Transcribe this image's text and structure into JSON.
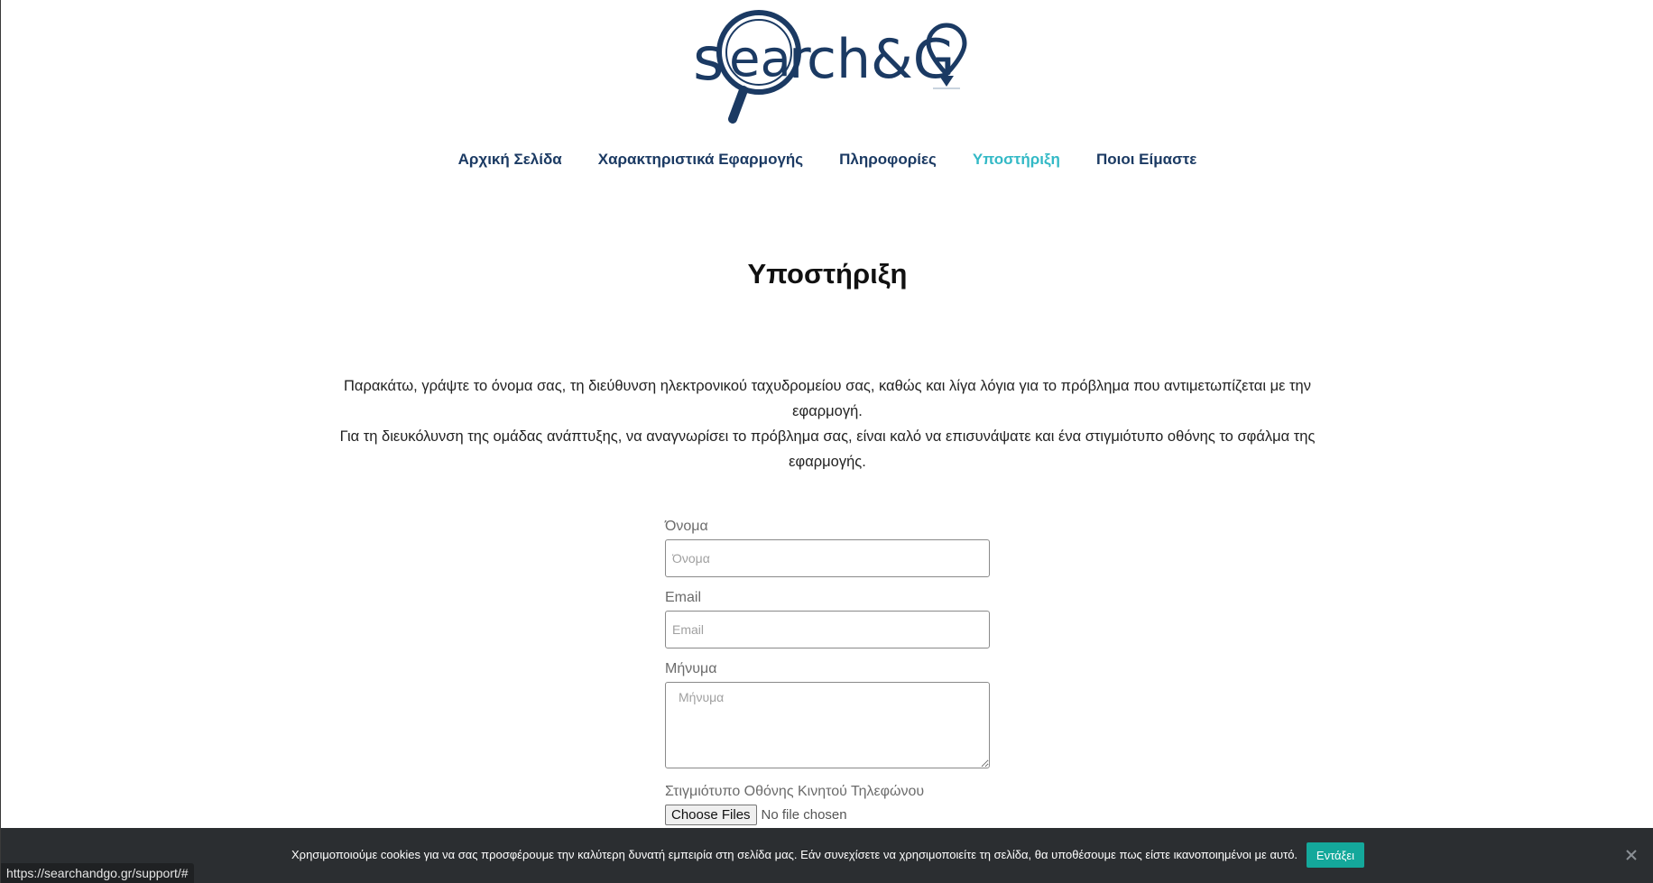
{
  "brand": {
    "logo_text": "search&GO",
    "colors": {
      "primary": "#1b3a63",
      "accent": "#33b9c6",
      "button": "#14a89b",
      "cookie_bar": "#2b2e31"
    }
  },
  "nav": {
    "items": [
      {
        "label": "Αρχική Σελίδα",
        "active": false
      },
      {
        "label": "Χαρακτηριστικά Εφαρμογής",
        "active": false
      },
      {
        "label": "Πληροφορίες",
        "active": false
      },
      {
        "label": "Υποστήριξη",
        "active": true
      },
      {
        "label": "Ποιοι Είμαστε",
        "active": false
      }
    ]
  },
  "page": {
    "title": "Υποστήριξη",
    "intro_1": "Παρακάτω, γράψτε το όνομα σας, τη διεύθυνση ηλεκτρονικού ταχυδρομείου σας, καθώς και λίγα λόγια για το πρόβλημα που αντιμετωπίζεται με την εφαρμογή.",
    "intro_2": "Για τη διευκόλυνση της ομάδας ανάπτυξης, να αναγνωρίσει το πρόβλημα σας, είναι καλό να επισυνάψατε και ένα στιγμιότυπο οθόνης το σφάλμα της εφαρμογής."
  },
  "form": {
    "name_label": "Όνομα",
    "name_placeholder": "Όνομα",
    "email_label": "Email",
    "email_placeholder": "Email",
    "message_label": "Μήνυμα",
    "message_placeholder": "Μήνυμα",
    "screenshot_label": "Στιγμιότυπο Οθόνης Κινητού Τηλεφώνου",
    "file_button": "Choose Files",
    "file_status": "No file chosen"
  },
  "cookie": {
    "text": "Χρησιμοποιούμε cookies για να σας προσφέρουμε την καλύτερη δυνατή εμπειρία στη σελίδα μας. Εάν συνεχίσετε να χρησιμοποιείτε τη σελίδα, θα υποθέσουμε πως είστε ικανοποιημένοι με αυτό.",
    "accept_label": "Εντάξει",
    "close_icon": "close-icon"
  },
  "status_bar": {
    "url": "https://searchandgo.gr/support/#"
  }
}
